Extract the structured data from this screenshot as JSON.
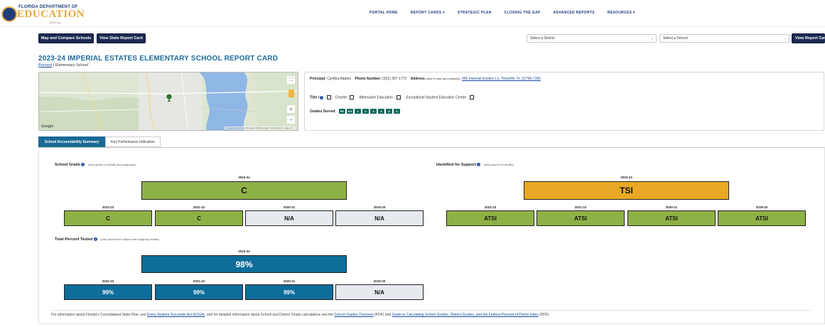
{
  "header": {
    "logo_top": "FLORIDA DEPARTMENT OF",
    "logo_main": "EDUCATION",
    "logo_sub": "fldoe.org",
    "nav": [
      "PORTAL HOME",
      "REPORT CARDS ▾",
      "STRATEGIC PLAN",
      "CLOSING THE GAP",
      "ADVANCED REPORTS",
      "RESOURCES ▾"
    ]
  },
  "actions": {
    "map_compare": "Map and Compare Schools",
    "view_state": "View State Report Card",
    "district_placeholder": "Select a District",
    "school_placeholder": "Select a School",
    "view_report": "View Report Card"
  },
  "school": {
    "title": "2023-24 IMPERIAL ESTATES ELEMENTARY SCHOOL REPORT CARD",
    "district": "Brevard",
    "type": "Elementary School"
  },
  "info": {
    "principal_label": "Principal:",
    "principal": "Cynthia Adams",
    "phone_label": "Phone Number:",
    "phone": "(321) 267-1773",
    "address_label": "Address",
    "address_note": "(click to map and compare):",
    "address": "900 Imperial Estates Ln, Titusville, FL 32796-7165",
    "title1": "Title I",
    "charter": "Charter:",
    "alternative": "Alternative Education :",
    "ese": "Exceptional Student Education Center :",
    "grades_label": "Grades Served:",
    "grades": [
      "PK",
      "KG",
      "1",
      "2",
      "3",
      "4",
      "5",
      "6"
    ]
  },
  "map": {
    "attribution": "Keyboard shortcuts   Map data ©2024 Google   Terms   Report a map error",
    "google": "Google"
  },
  "tabs": [
    "School Accountability Summary",
    "Key Performance Indicators"
  ],
  "grade": {
    "heading": "School Grade",
    "note": "(click grade for details and subgroups)",
    "current_year": "2023-24",
    "current": "C",
    "history": [
      {
        "year": "2022-23",
        "value": "C",
        "color": "green"
      },
      {
        "year": "2021-22",
        "value": "C",
        "color": "green"
      },
      {
        "year": "2020-21",
        "value": "N/A",
        "color": "grey"
      },
      {
        "year": "2019-20",
        "value": "N/A",
        "color": "grey"
      }
    ]
  },
  "support": {
    "heading": "Identified for Support",
    "note": "(click yes/no for details)",
    "current_year": "2023-24",
    "current": "TSI",
    "history": [
      {
        "year": "2022-23",
        "value": "ATSI"
      },
      {
        "year": "2021-22",
        "value": "ATSI"
      },
      {
        "year": "2020-21",
        "value": "ATSI"
      },
      {
        "year": "2019-20",
        "value": "ATSI"
      }
    ]
  },
  "tested": {
    "heading": "Total Percent Tested",
    "note": "(click percent for subject and subgroup details)",
    "current_year": "2023-24",
    "current": "98%",
    "history": [
      {
        "year": "2022-23",
        "value": "99%",
        "color": "blue"
      },
      {
        "year": "2021-22",
        "value": "99%",
        "color": "blue"
      },
      {
        "year": "2020-21",
        "value": "99%",
        "color": "blue"
      },
      {
        "year": "2019-20",
        "value": "N/A",
        "color": "grey"
      }
    ]
  },
  "footer": {
    "t1": "For information about Florida's Consolidated State Plan, see",
    "l1": "Every Student Succeeds Act (ESSA)",
    "t2": ", and for detailed information about School and District Grade calculations see the",
    "l2": "School Grades Overview",
    "t3": "(PDF) and",
    "l3": "Guide to Calculating School Grades, District Grades, and the Federal Percent of Points Index",
    "t4": "(PDF)."
  },
  "colors": {
    "green": "#8eb146",
    "gold": "#e9a924",
    "blue": "#0e6d9a",
    "grey": "#e6eaee",
    "navy": "#1b2a52"
  }
}
